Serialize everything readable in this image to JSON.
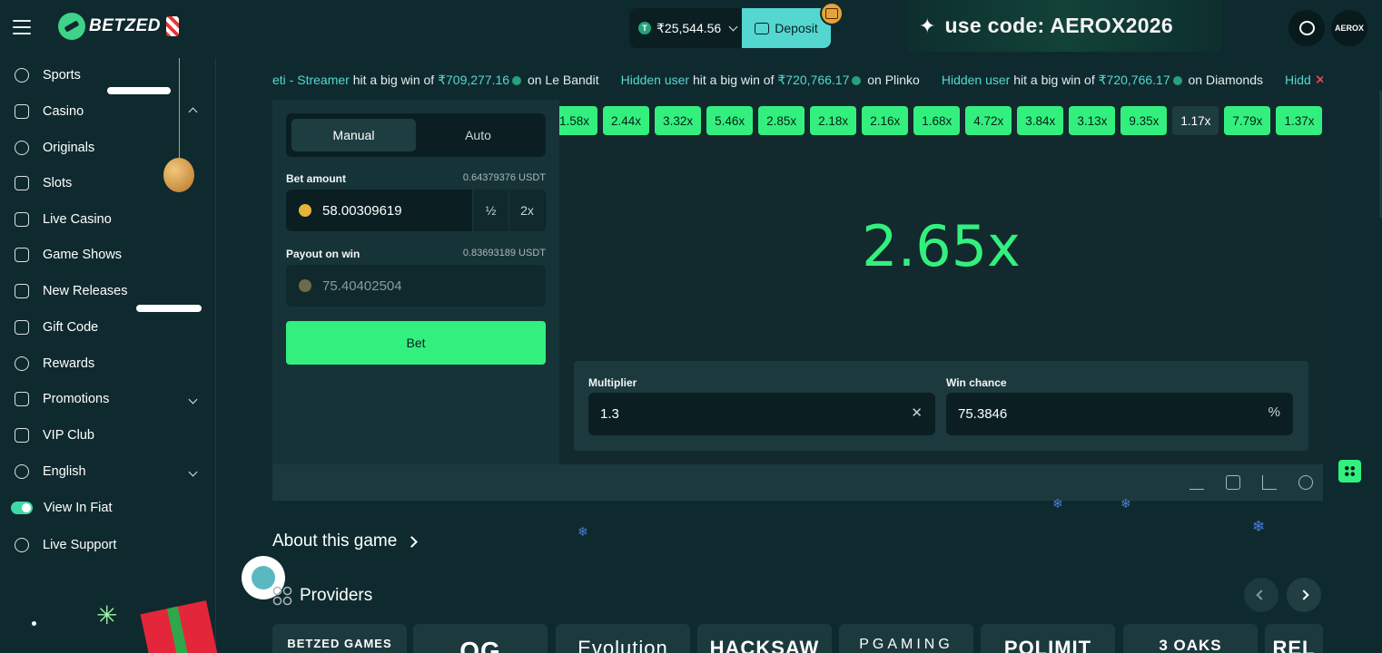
{
  "header": {
    "brand": "BETZED",
    "balance": "₹25,544.56",
    "deposit_label": "Deposit",
    "promo_text": "use code: AEROX2026",
    "avatar_text": "AEROX"
  },
  "sidebar": {
    "items": [
      {
        "label": "Sports",
        "icon": "sports-icon"
      },
      {
        "label": "Casino",
        "icon": "casino-icon"
      },
      {
        "label": "Originals",
        "icon": "originals-icon"
      },
      {
        "label": "Slots",
        "icon": "slots-icon"
      },
      {
        "label": "Live Casino",
        "icon": "live-casino-icon"
      },
      {
        "label": "Game Shows",
        "icon": "game-shows-icon"
      },
      {
        "label": "New Releases",
        "icon": "new-releases-icon"
      },
      {
        "label": "Gift Code",
        "icon": "gift-icon"
      },
      {
        "label": "Rewards",
        "icon": "rewards-icon"
      },
      {
        "label": "Promotions",
        "icon": "promotions-icon"
      },
      {
        "label": "VIP Club",
        "icon": "crown-icon"
      },
      {
        "label": "English",
        "icon": "globe-icon"
      },
      {
        "label": "View In Fiat",
        "icon": "toggle"
      },
      {
        "label": "Live Support",
        "icon": "headset-icon"
      }
    ]
  },
  "ticker": {
    "items": [
      {
        "user": "eti - Streamer",
        "text": " hit a big win of ",
        "amount": "₹709,277.16",
        "game": " on Le Bandit"
      },
      {
        "user": "Hidden user",
        "text": " hit a big win of ",
        "amount": "₹720,766.17",
        "game": " on Plinko"
      },
      {
        "user": "Hidden user",
        "text": " hit a big win of ",
        "amount": "₹720,766.17",
        "game": " on Diamonds"
      },
      {
        "user": "Hidd",
        "text": "",
        "amount": "",
        "game": ""
      }
    ]
  },
  "bet_panel": {
    "tab_manual": "Manual",
    "tab_auto": "Auto",
    "bet_amount_label": "Bet amount",
    "bet_amount_usdt": "0.64379376 USDT",
    "bet_amount_value": "58.00309619",
    "half_label": "½",
    "double_label": "2x",
    "payout_label": "Payout on win",
    "payout_usdt": "0.83693189 USDT",
    "payout_value": "75.40402504",
    "bet_button": "Bet"
  },
  "history": [
    {
      "v": "1.58x",
      "win": true
    },
    {
      "v": "2.44x",
      "win": true
    },
    {
      "v": "3.32x",
      "win": true
    },
    {
      "v": "5.46x",
      "win": true
    },
    {
      "v": "2.85x",
      "win": true
    },
    {
      "v": "2.18x",
      "win": true
    },
    {
      "v": "2.16x",
      "win": true
    },
    {
      "v": "1.68x",
      "win": true
    },
    {
      "v": "4.72x",
      "win": true
    },
    {
      "v": "3.84x",
      "win": true
    },
    {
      "v": "3.13x",
      "win": true
    },
    {
      "v": "9.35x",
      "win": true
    },
    {
      "v": "1.17x",
      "win": false
    },
    {
      "v": "7.79x",
      "win": true
    },
    {
      "v": "1.37x",
      "win": true
    },
    {
      "v": "2.65x",
      "win": true
    }
  ],
  "game": {
    "result": "2.65x",
    "multiplier_label": "Multiplier",
    "multiplier_value": "1.3",
    "clear_symbol": "✕",
    "win_chance_label": "Win chance",
    "win_chance_value": "75.3846",
    "percent_symbol": "%"
  },
  "about": {
    "label": "About this game"
  },
  "providers": {
    "label": "Providers",
    "cards": [
      "BETZED GAMES",
      "OG",
      "Evolution",
      "HACKSAW",
      "PGAMING",
      "POLIMIT",
      "3 OAKS",
      "REL"
    ]
  }
}
